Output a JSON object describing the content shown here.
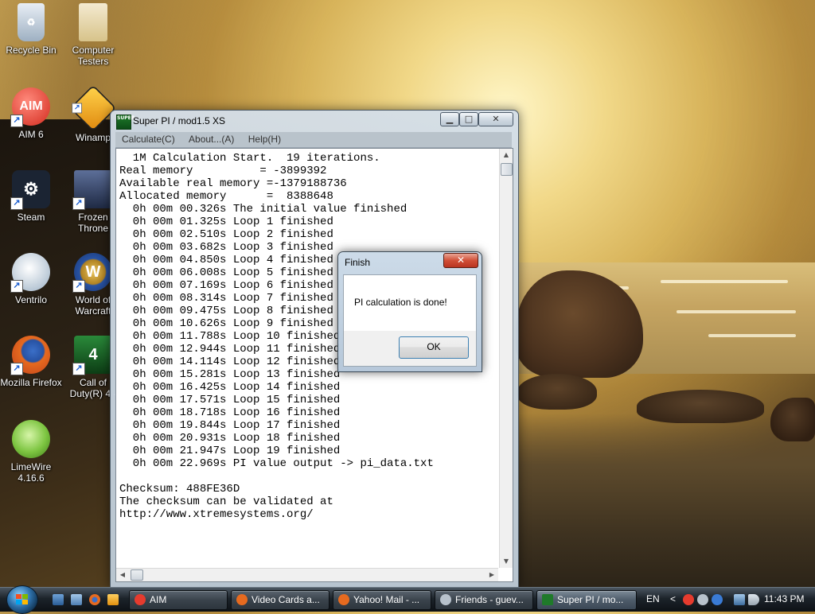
{
  "desktop": {
    "icons": [
      {
        "label": "Recycle Bin",
        "color": "#cfd8e3"
      },
      {
        "label": "Computer Testers",
        "color": "#e8d9a6"
      },
      {
        "label": "AIM 6",
        "color": "#e63b2e"
      },
      {
        "label": "Winamp",
        "color": "#f1a01e"
      },
      {
        "label": "Steam",
        "color": "#1b2433"
      },
      {
        "label": "Frozen Throne",
        "color": "#2c3a57"
      },
      {
        "label": "Ventrilo",
        "color": "#dfe7ee"
      },
      {
        "label": "World of Warcraft",
        "color": "#2752a3"
      },
      {
        "label": "Mozilla Firefox",
        "color": "#e66a1f"
      },
      {
        "label": "Call of Duty(R) 4 -",
        "color": "#1f6b2b"
      },
      {
        "label": "LimeWire 4.16.6",
        "color": "#7cc440"
      }
    ]
  },
  "window": {
    "title": "Super PI / mod1.5 XS",
    "icon_text": "SUPER",
    "buttons": {
      "minimize": "▁",
      "maximize": "□",
      "close": "✕"
    },
    "menu": [
      "Calculate(C)",
      "About...(A)",
      "Help(H)"
    ],
    "output_lines": [
      "  1M Calculation Start.  19 iterations.",
      "Real memory          = -3899392",
      "Available real memory =-1379188736",
      "Allocated memory      =  8388648",
      "  0h 00m 00.326s The initial value finished",
      "  0h 00m 01.325s Loop 1 finished",
      "  0h 00m 02.510s Loop 2 finished",
      "  0h 00m 03.682s Loop 3 finished",
      "  0h 00m 04.850s Loop 4 finished",
      "  0h 00m 06.008s Loop 5 finished",
      "  0h 00m 07.169s Loop 6 finished",
      "  0h 00m 08.314s Loop 7 finished",
      "  0h 00m 09.475s Loop 8 finished",
      "  0h 00m 10.626s Loop 9 finished",
      "  0h 00m 11.788s Loop 10 finished",
      "  0h 00m 12.944s Loop 11 finished",
      "  0h 00m 14.114s Loop 12 finished",
      "  0h 00m 15.281s Loop 13 finished",
      "  0h 00m 16.425s Loop 14 finished",
      "  0h 00m 17.571s Loop 15 finished",
      "  0h 00m 18.718s Loop 16 finished",
      "  0h 00m 19.844s Loop 17 finished",
      "  0h 00m 20.931s Loop 18 finished",
      "  0h 00m 21.947s Loop 19 finished",
      "  0h 00m 22.969s PI value output -> pi_data.txt",
      "",
      "Checksum: 488FE36D",
      "The checksum can be validated at",
      "http://www.xtremesystems.org/"
    ]
  },
  "dialog": {
    "title": "Finish",
    "message": "PI calculation is done!",
    "ok_label": "OK",
    "close_glyph": "✕"
  },
  "taskbar": {
    "tasks": [
      {
        "label": "AIM",
        "icon_color": "#e63b2e",
        "active": false
      },
      {
        "label": "Video Cards a...",
        "icon_color": "#e66a1f",
        "active": false
      },
      {
        "label": "Yahoo! Mail - ...",
        "icon_color": "#e66a1f",
        "active": false
      },
      {
        "label": "Friends - guev...",
        "icon_color": "#b8c2cc",
        "active": false
      },
      {
        "label": "Super PI / mo...",
        "icon_color": "#1f7a2a",
        "active": true
      }
    ],
    "language": "EN",
    "clock": "11:43 PM",
    "tray_arrow": "<"
  }
}
